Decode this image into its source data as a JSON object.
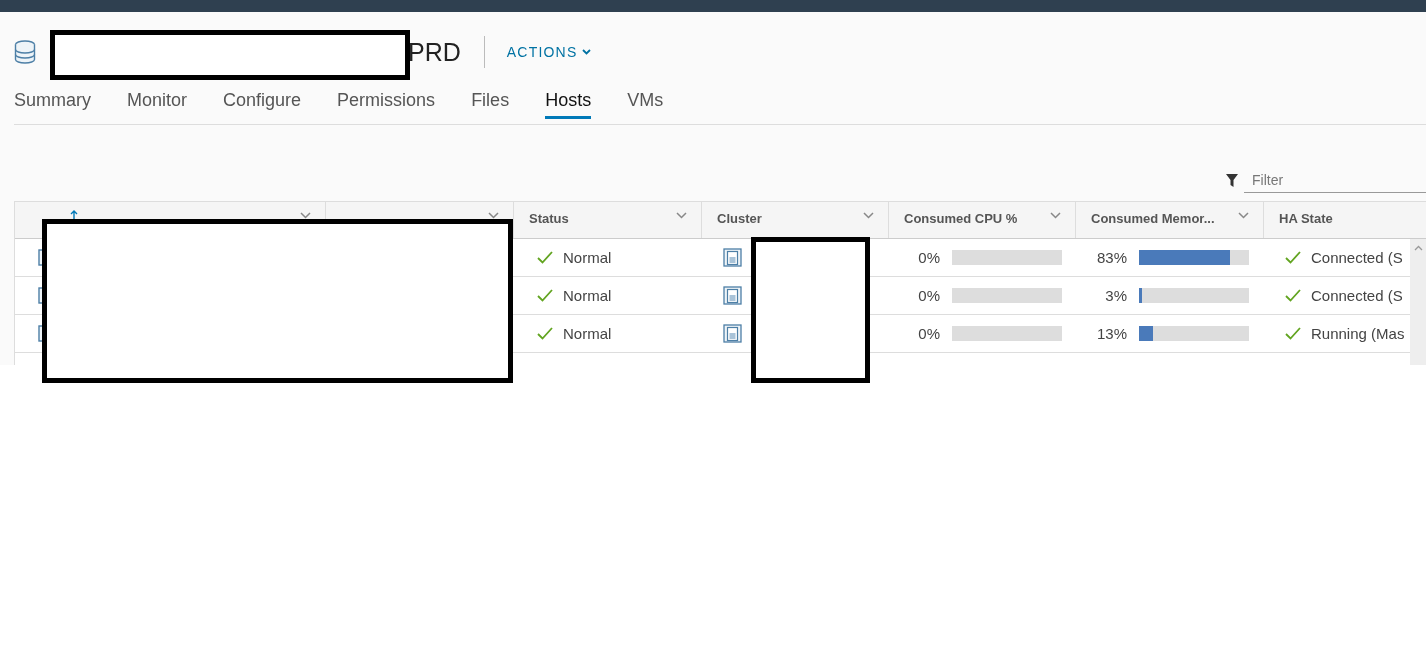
{
  "header": {
    "title_suffix": "PRD",
    "actions": "ACTIONS"
  },
  "tabs": [
    {
      "label": "Summary",
      "selected": false
    },
    {
      "label": "Monitor",
      "selected": false
    },
    {
      "label": "Configure",
      "selected": false
    },
    {
      "label": "Permissions",
      "selected": false
    },
    {
      "label": "Files",
      "selected": false
    },
    {
      "label": "Hosts",
      "selected": true
    },
    {
      "label": "VMs",
      "selected": false
    }
  ],
  "filter": {
    "placeholder": "Filter"
  },
  "table": {
    "columns": [
      {
        "sorted_ascending": true,
        "menu": true
      },
      {
        "sorted_ascending": false,
        "menu": true
      },
      {
        "label": "Status",
        "sorted_ascending": false,
        "menu": true
      },
      {
        "label": "Cluster",
        "sorted_ascending": false,
        "menu": true
      },
      {
        "label": "Consumed CPU %",
        "sorted_ascending": false,
        "menu": true
      },
      {
        "label": "Consumed Memor...",
        "sorted_ascending": false,
        "menu": true
      },
      {
        "label": "HA State",
        "sorted_ascending": false,
        "menu": false
      }
    ],
    "rows": [
      {
        "status": {
          "kind": "ok",
          "label": "Normal"
        },
        "cpu": {
          "reading": "0%"
        },
        "memory": {
          "reading": "83%",
          "level": 0.83
        },
        "ha_state": {
          "kind": "ok",
          "label": "Connected (S"
        }
      },
      {
        "status": {
          "kind": "ok",
          "label": "Normal"
        },
        "cpu": {
          "reading": "0%"
        },
        "memory": {
          "reading": "3%",
          "level": 0.03
        },
        "ha_state": {
          "kind": "ok",
          "label": "Connected (S"
        }
      },
      {
        "status": {
          "kind": "ok",
          "label": "Normal"
        },
        "cpu": {
          "reading": "0%"
        },
        "memory": {
          "reading": "13%",
          "level": 0.13
        },
        "ha_state": {
          "kind": "ok",
          "label": "Running (Mas"
        }
      }
    ]
  }
}
